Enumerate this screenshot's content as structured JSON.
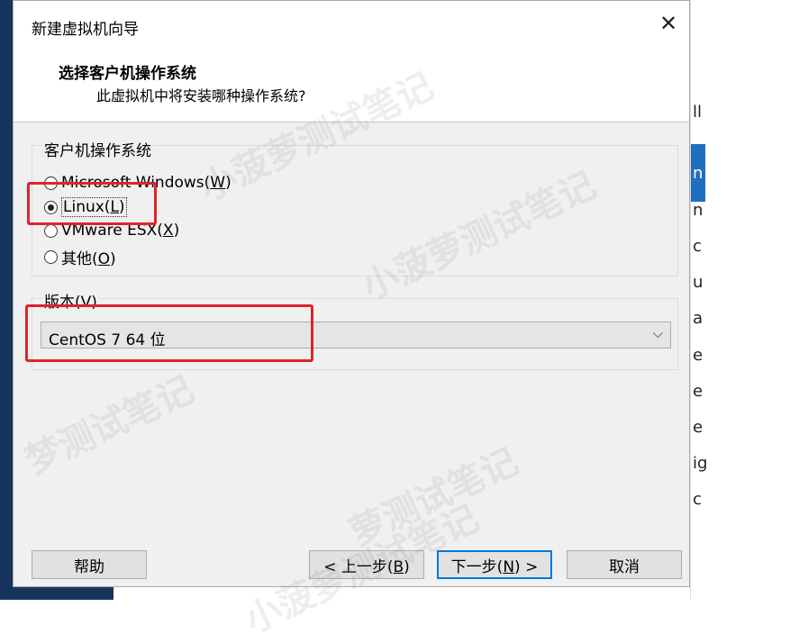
{
  "dialog": {
    "title": "新建虚拟机向导",
    "close_glyph": "✕",
    "header_title": "选择客户机操作系统",
    "header_subtitle": "此虚拟机中将安装哪种操作系统?"
  },
  "os_group": {
    "label": "客户机操作系统",
    "options": [
      {
        "label": "Microsoft Windows(",
        "key": "W",
        "close": ")",
        "checked": false
      },
      {
        "label": "Linux(",
        "key": "L",
        "close": ")",
        "checked": true
      },
      {
        "label": "VMware ESX(",
        "key": "X",
        "close": ")",
        "checked": false
      },
      {
        "label": "其他(",
        "key": "O",
        "close": ")",
        "checked": false
      }
    ]
  },
  "version_group": {
    "label": "版本(V)",
    "selected": "CentOS 7 64 位",
    "arrow": "⌵"
  },
  "buttons": {
    "help": "帮助",
    "back_prefix": "< 上一步(",
    "back_key": "B",
    "back_suffix": ")",
    "next_prefix": "下一步(",
    "next_key": "N",
    "next_suffix": ") >",
    "cancel": "取消"
  },
  "background_window": {
    "letters": [
      "ll",
      "n",
      "n",
      "c",
      "u",
      "a",
      "e",
      "e",
      "e",
      "ig",
      "c"
    ]
  },
  "watermark": {
    "text_1": "小菠萝测试笔记",
    "text_2": "萝测试笔记",
    "text_3": "梦测试笔记"
  },
  "colors": {
    "annotation": "#e0232b",
    "primary_button_border": "#0078d7"
  }
}
